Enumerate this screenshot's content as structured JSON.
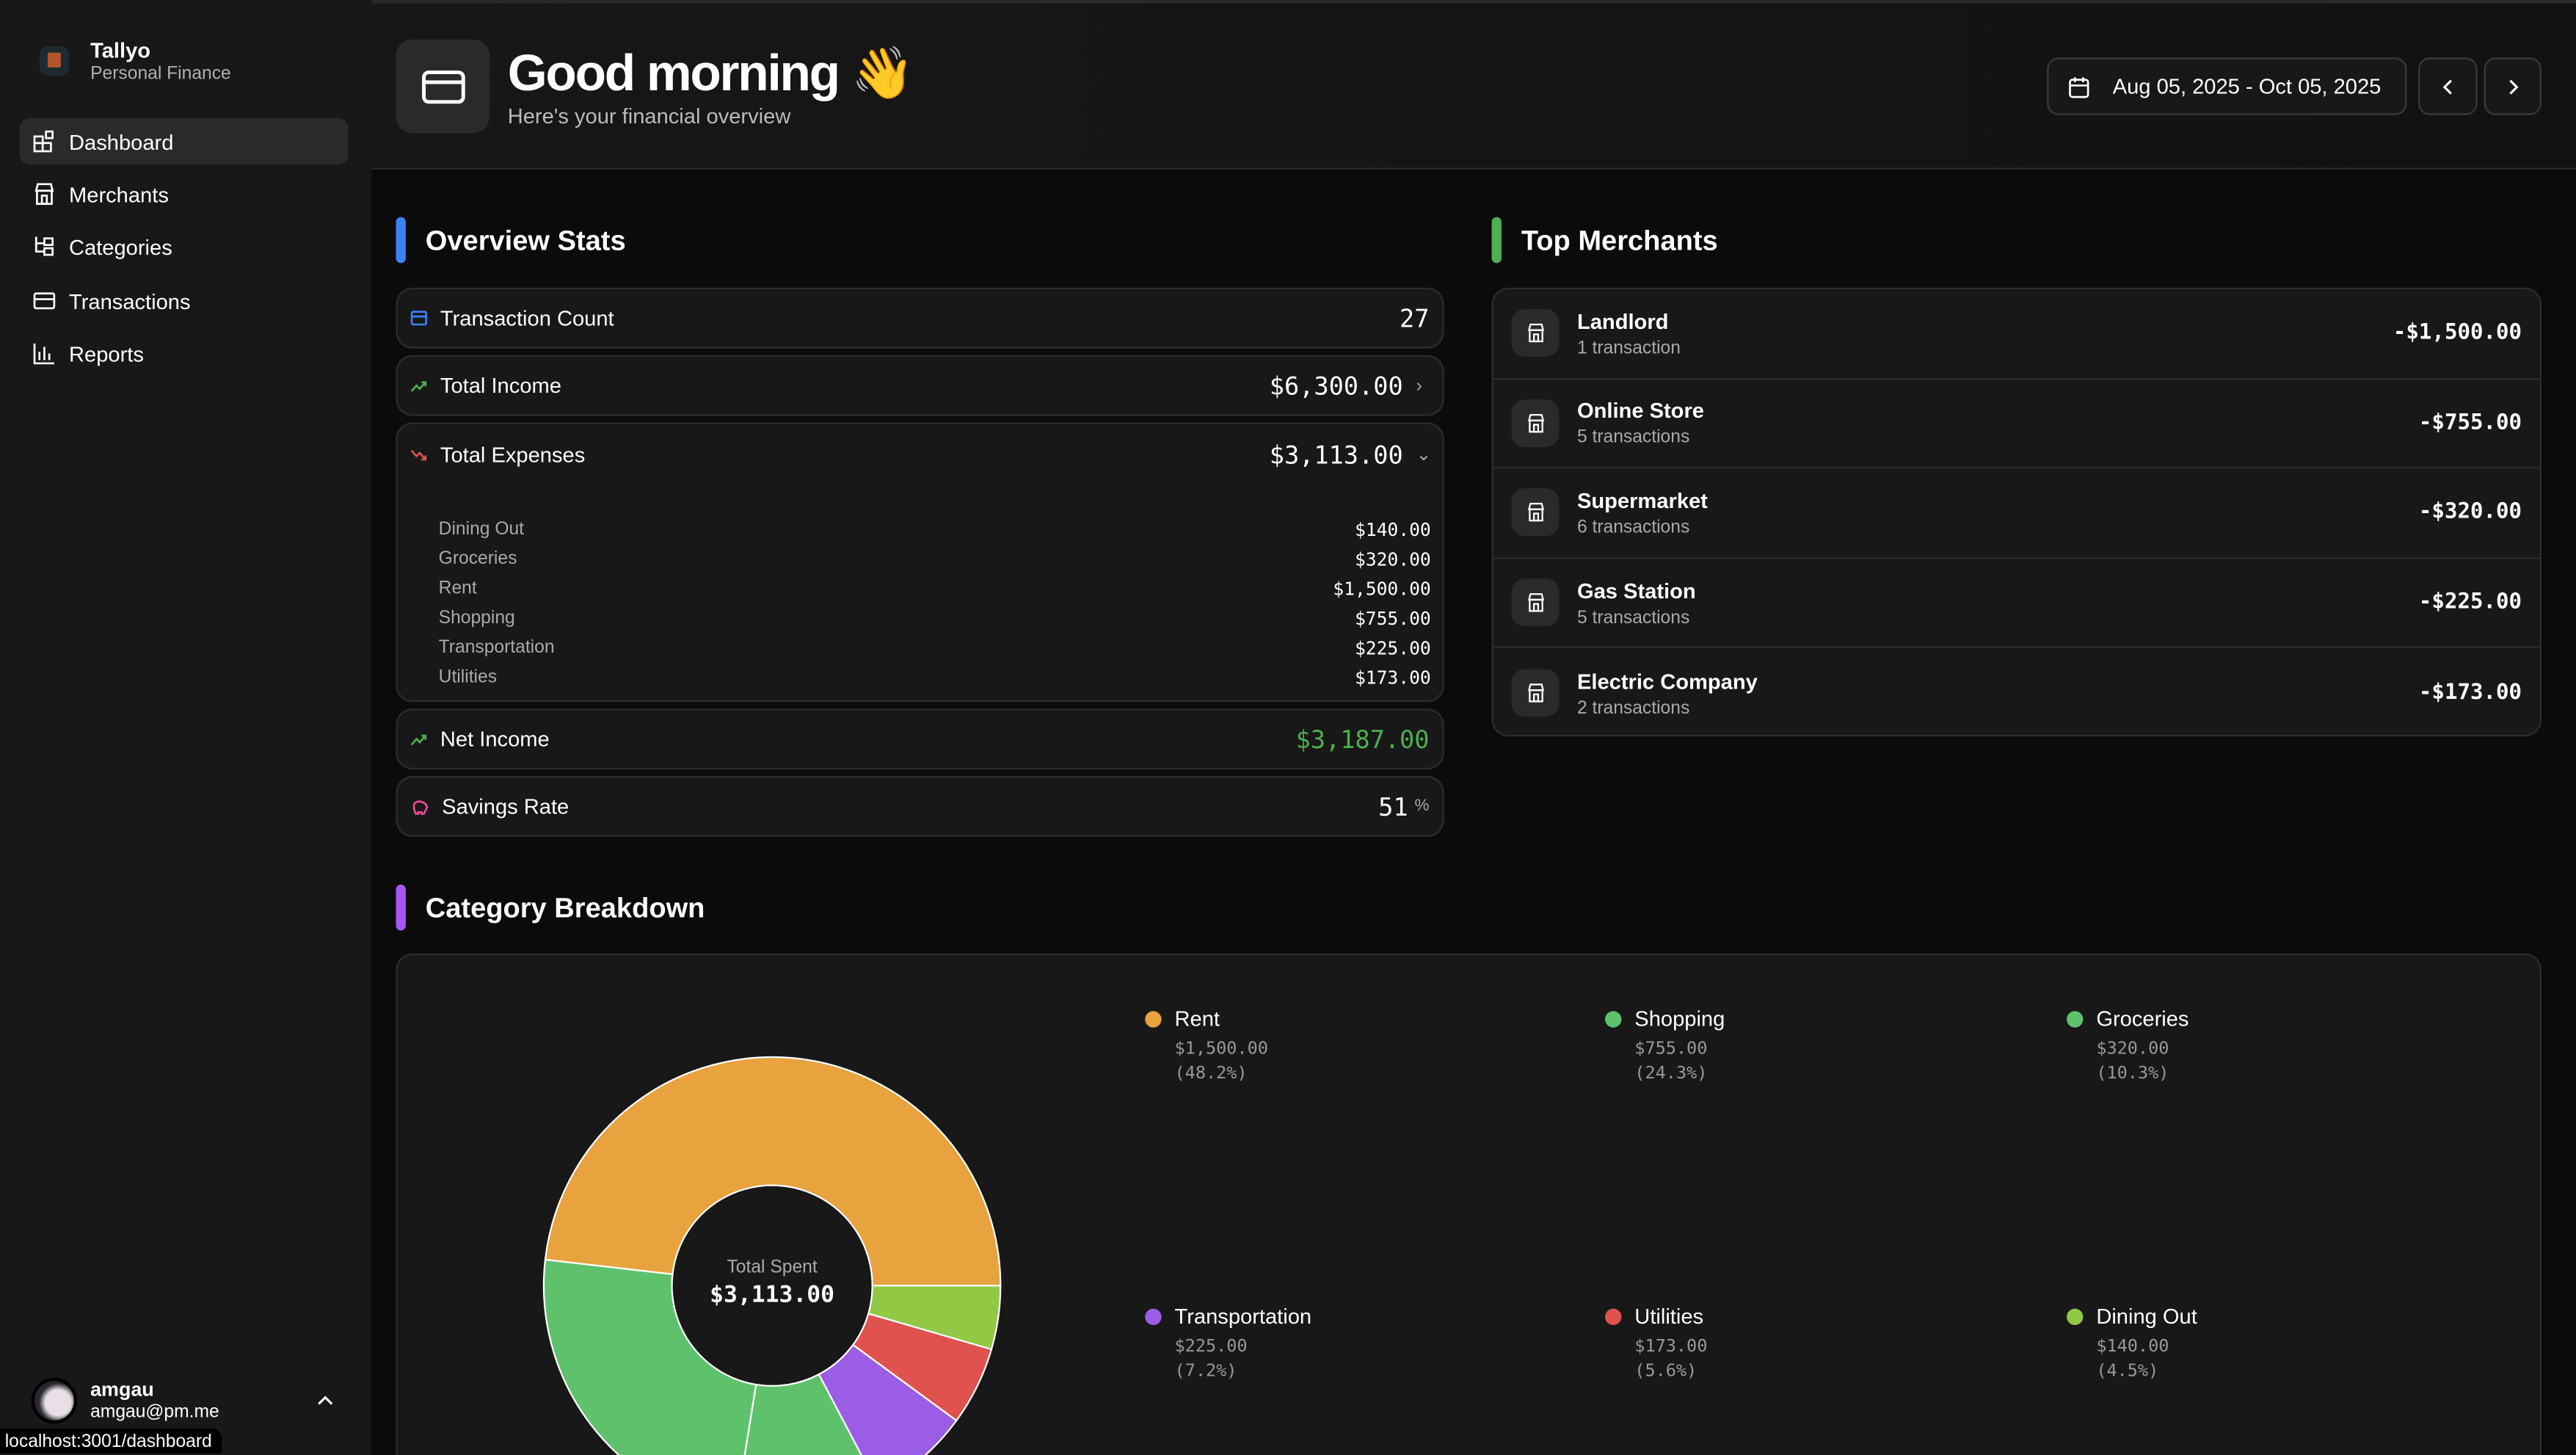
{
  "app": {
    "name": "Tallyo",
    "subtitle": "Personal Finance"
  },
  "sidebar": {
    "items": [
      {
        "label": "Dashboard",
        "icon": "dashboard-icon"
      },
      {
        "label": "Merchants",
        "icon": "store-icon"
      },
      {
        "label": "Categories",
        "icon": "tree-icon"
      },
      {
        "label": "Transactions",
        "icon": "card-icon"
      },
      {
        "label": "Reports",
        "icon": "bar-chart-icon"
      }
    ],
    "user": {
      "name": "amgau",
      "email": "amgau@pm.me"
    }
  },
  "status_url": "localhost:3001/dashboard",
  "header": {
    "title": "Good morning 👋",
    "subtitle": "Here's your financial overview",
    "date_range": "Aug 05, 2025 - Oct 05, 2025"
  },
  "overview": {
    "title": "Overview Stats",
    "transaction_count": {
      "label": "Transaction Count",
      "value": "27"
    },
    "total_income": {
      "label": "Total Income",
      "value": "$6,300.00"
    },
    "total_expenses": {
      "label": "Total Expenses",
      "value": "$3,113.00",
      "items": [
        {
          "name": "Dining Out",
          "value": "$140.00"
        },
        {
          "name": "Groceries",
          "value": "$320.00"
        },
        {
          "name": "Rent",
          "value": "$1,500.00"
        },
        {
          "name": "Shopping",
          "value": "$755.00"
        },
        {
          "name": "Transportation",
          "value": "$225.00"
        },
        {
          "name": "Utilities",
          "value": "$173.00"
        }
      ]
    },
    "net_income": {
      "label": "Net Income",
      "value": "$3,187.00"
    },
    "savings_rate": {
      "label": "Savings Rate",
      "value": "51",
      "unit": "%"
    }
  },
  "merchants": {
    "title": "Top Merchants",
    "items": [
      {
        "name": "Landlord",
        "count": "1 transaction",
        "amount": "-$1,500.00"
      },
      {
        "name": "Online Store",
        "count": "5 transactions",
        "amount": "-$755.00"
      },
      {
        "name": "Supermarket",
        "count": "6 transactions",
        "amount": "-$320.00"
      },
      {
        "name": "Gas Station",
        "count": "5 transactions",
        "amount": "-$225.00"
      },
      {
        "name": "Electric Company",
        "count": "2 transactions",
        "amount": "-$173.00"
      }
    ]
  },
  "colors": {
    "blue": "#3b82f6",
    "green": "#4caf50",
    "purple": "#a855f7",
    "red": "#e0524e"
  },
  "chart_data": {
    "type": "pie",
    "title": "Category Breakdown",
    "center_label": "Total Spent",
    "center_value": "$3,113.00",
    "slices": [
      {
        "name": "Rent",
        "value": 1500,
        "amount": "$1,500.00",
        "pct": "(48.2%)",
        "color": "#e8a23e"
      },
      {
        "name": "Shopping",
        "value": 755,
        "amount": "$755.00",
        "pct": "(24.3%)",
        "color": "#5ec26c"
      },
      {
        "name": "Groceries",
        "value": 320,
        "amount": "$320.00",
        "pct": "(10.3%)",
        "color": "#5ec26c"
      },
      {
        "name": "Transportation",
        "value": 225,
        "amount": "$225.00",
        "pct": "(7.2%)",
        "color": "#9b5de5"
      },
      {
        "name": "Utilities",
        "value": 173,
        "amount": "$173.00",
        "pct": "(5.6%)",
        "color": "#df524e"
      },
      {
        "name": "Dining Out",
        "value": 140,
        "amount": "$140.00",
        "pct": "(4.5%)",
        "color": "#92c944"
      }
    ]
  }
}
